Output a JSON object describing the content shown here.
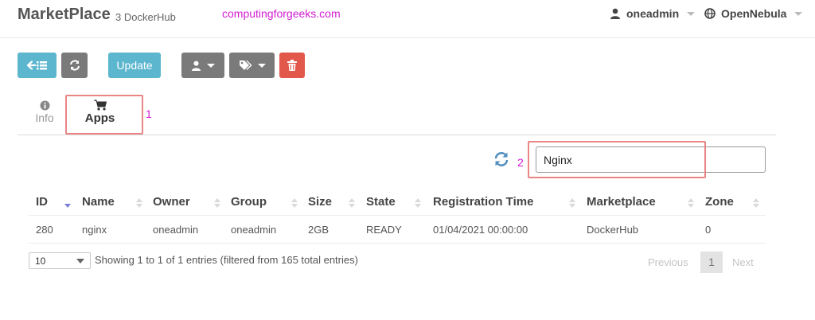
{
  "header": {
    "title": "MarketPlace",
    "subtitle": "3 DockerHub",
    "watermark": "computingforgeeks.com",
    "user": "oneadmin",
    "zone": "OpenNebula"
  },
  "toolbar": {
    "back_icon": "back-to-list-icon",
    "refresh_icon": "refresh-icon",
    "update_label": "Update",
    "user_icon": "user-icon",
    "tag_icon": "tags-icon",
    "delete_icon": "trash-icon",
    "colors": {
      "info": "#5bb6ce",
      "neutral": "#7a7a7a",
      "danger": "#e2584a"
    }
  },
  "tabs": {
    "info_label": "Info",
    "apps_label": "Apps"
  },
  "annotations": {
    "marker_1": "1",
    "marker_2": "2",
    "color": "#d21bd2",
    "box_color": "#ea8585"
  },
  "search": {
    "value": "Nginx"
  },
  "table": {
    "columns": [
      "ID",
      "Name",
      "Owner",
      "Group",
      "Size",
      "State",
      "Registration Time",
      "Marketplace",
      "Zone"
    ],
    "rows": [
      [
        "280",
        "nginx",
        "oneadmin",
        "oneadmin",
        "2GB",
        "READY",
        "01/04/2021 00:00:00",
        "DockerHub",
        "0"
      ]
    ]
  },
  "footer": {
    "page_size": "10",
    "info": "Showing 1 to 1 of 1 entries (filtered from 165 total entries)",
    "previous": "Previous",
    "current_page": "1",
    "next": "Next"
  }
}
